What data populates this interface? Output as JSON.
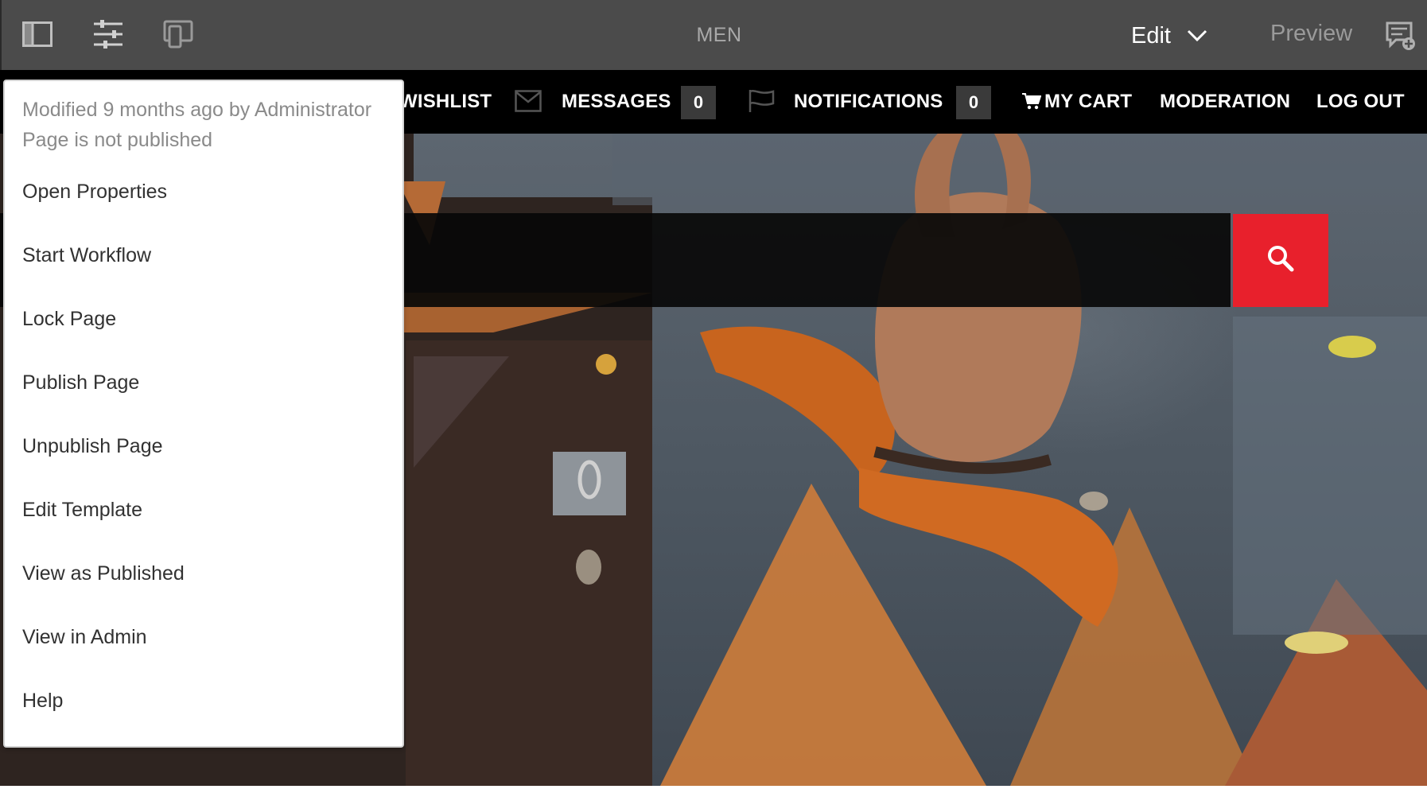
{
  "toolbar": {
    "icons": [
      "side-panel-icon",
      "page-properties-icon",
      "emulator-icon",
      "annotations-icon"
    ],
    "page_name": "MEN",
    "mode": "Edit",
    "preview_label": "Preview"
  },
  "nav": {
    "wishlist_label": "WISHLIST",
    "messages_label": "MESSAGES",
    "messages_count": "0",
    "notifications_label": "NOTIFICATIONS",
    "notifications_count": "0",
    "cart_label": "MY CART",
    "moderation_label": "MODERATION",
    "logout_label": "LOG OUT"
  },
  "page_info": {
    "modified": "Modified 9 months ago by Administrator",
    "status": "Page is not published",
    "items": [
      "Open Properties",
      "Start Workflow",
      "Lock Page",
      "Publish Page",
      "Unpublish Page",
      "Edit Template",
      "View as Published",
      "View in Admin",
      "Help"
    ]
  },
  "colors": {
    "toolbar_bg": "#4b4b4b",
    "nav_bg": "#000000",
    "search_button": "#e8202c",
    "menu_bg": "#ffffff"
  }
}
